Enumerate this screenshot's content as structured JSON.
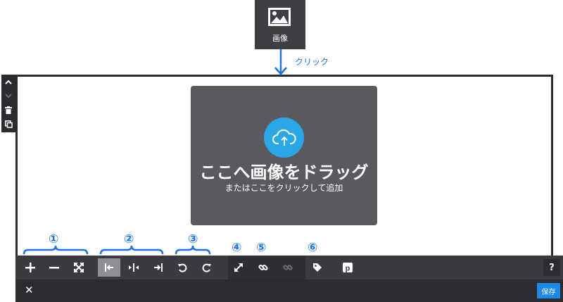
{
  "widget": {
    "icon": "image-icon",
    "label": "画像"
  },
  "annotation": {
    "click_label": "クリック"
  },
  "side_tools": {
    "icons": [
      "chevron-up-icon",
      "chevron-down-icon",
      "trash-icon",
      "duplicate-icon"
    ]
  },
  "dropzone": {
    "icon": "cloud-upload-icon",
    "title": "ここへ画像をドラッグ",
    "subtitle": "またはここをクリックして追加"
  },
  "callouts": [
    "①",
    "②",
    "③",
    "④",
    "⑤",
    "⑥"
  ],
  "toolbar": {
    "zoom": [
      "plus-icon",
      "minus-icon",
      "fit-icon"
    ],
    "align": [
      "align-left-icon",
      "align-center-icon",
      "align-right-icon"
    ],
    "rotate": [
      "rotate-left-icon",
      "rotate-right-icon"
    ],
    "other": [
      "resize-icon",
      "link-icon",
      "unlink-icon",
      "tag-icon",
      "pinterest-icon"
    ],
    "help_label": "?"
  },
  "statusbar": {
    "close_label": "✕",
    "save_label": "保存"
  },
  "colors": {
    "accent": "#1a73e8",
    "upload": "#29a7e6",
    "toolbar": "#3a3b3f",
    "save": "#1e88e5"
  }
}
